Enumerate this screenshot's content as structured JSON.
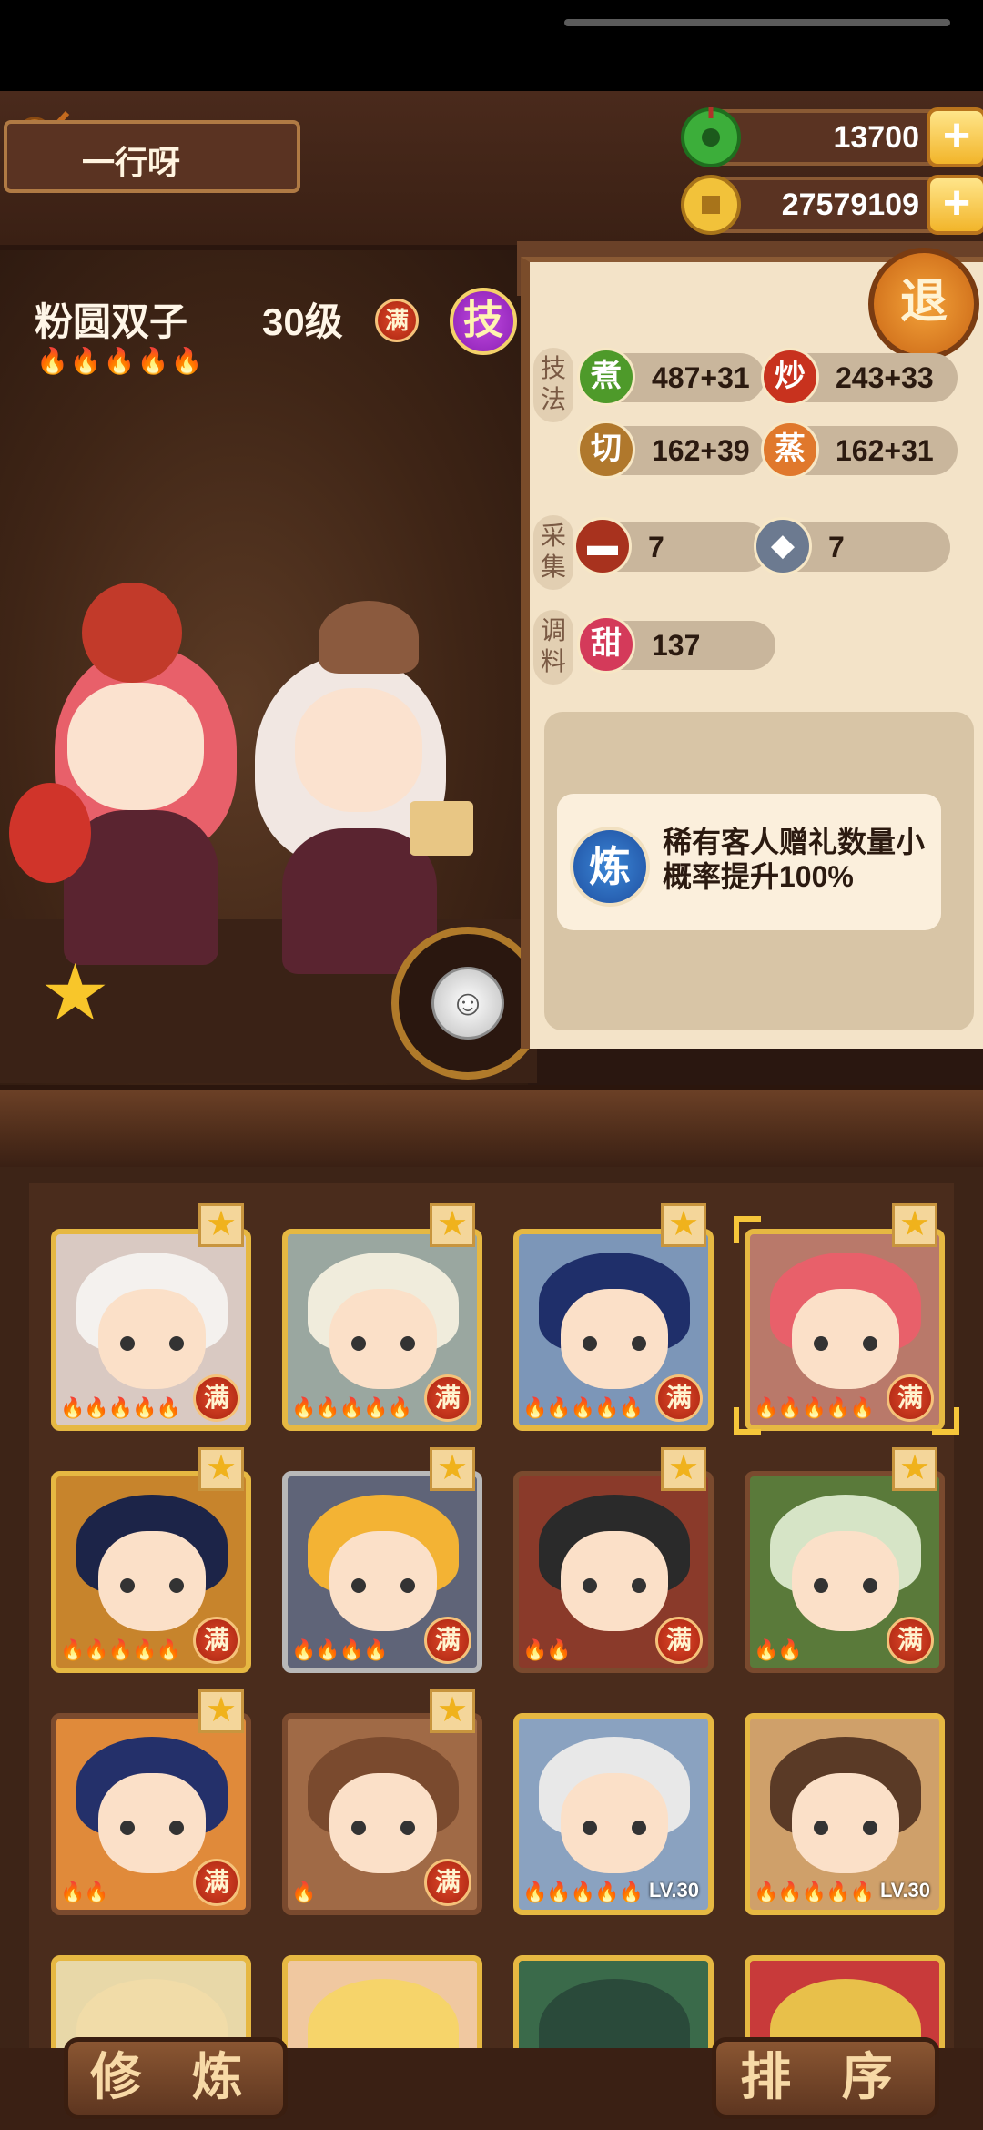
{
  "player": {
    "name": "一行呀"
  },
  "currency": {
    "jade": "13700",
    "coins": "27579109"
  },
  "buttons": {
    "exit": "退",
    "skill": "技",
    "train": "修 炼",
    "sort": "排 序"
  },
  "character": {
    "name": "粉圆双子",
    "level": "30级",
    "full_badge": "满",
    "flames": "🔥🔥🔥🔥🔥",
    "rarity_level": 5
  },
  "stats": {
    "technique_label": "技法",
    "gather_label": "采集",
    "season_label": "调料",
    "boil": {
      "icon": "煮",
      "value": "487+31",
      "color": "#4e9a2a"
    },
    "fry": {
      "icon": "炒",
      "value": "243+33",
      "color": "#c8321e"
    },
    "cut": {
      "icon": "切",
      "value": "162+39",
      "color": "#b0782c"
    },
    "steam": {
      "icon": "蒸",
      "value": "162+31",
      "color": "#e0782c"
    },
    "meat": {
      "value": "7"
    },
    "fish": {
      "value": "7"
    },
    "sweet": {
      "icon": "甜",
      "value": "137"
    }
  },
  "effect": {
    "icon": "炼",
    "text": "稀有客人赠礼数量小概率提升100%"
  },
  "roster": [
    {
      "full": "满",
      "flames": "🔥🔥🔥🔥🔥",
      "star": true
    },
    {
      "full": "满",
      "flames": "🔥🔥🔥🔥🔥",
      "star": true
    },
    {
      "full": "满",
      "flames": "🔥🔥🔥🔥🔥",
      "star": true
    },
    {
      "full": "满",
      "flames": "🔥🔥🔥🔥🔥",
      "star": true
    },
    {
      "full": "满",
      "flames": "🔥🔥🔥🔥🔥",
      "star": true
    },
    {
      "full": "满",
      "flames": "🔥🔥🔥🔥",
      "star": true
    },
    {
      "full": "满",
      "flames": "🔥🔥",
      "star": true
    },
    {
      "full": "满",
      "flames": "🔥🔥",
      "star": true
    },
    {
      "full": "满",
      "flames": "🔥🔥",
      "star": true
    },
    {
      "full": "满",
      "flames": "🔥",
      "star": true
    },
    {
      "level": "LV.30",
      "flames": "🔥🔥🔥🔥🔥"
    },
    {
      "level": "LV.30",
      "flames": "🔥🔥🔥🔥🔥"
    }
  ]
}
